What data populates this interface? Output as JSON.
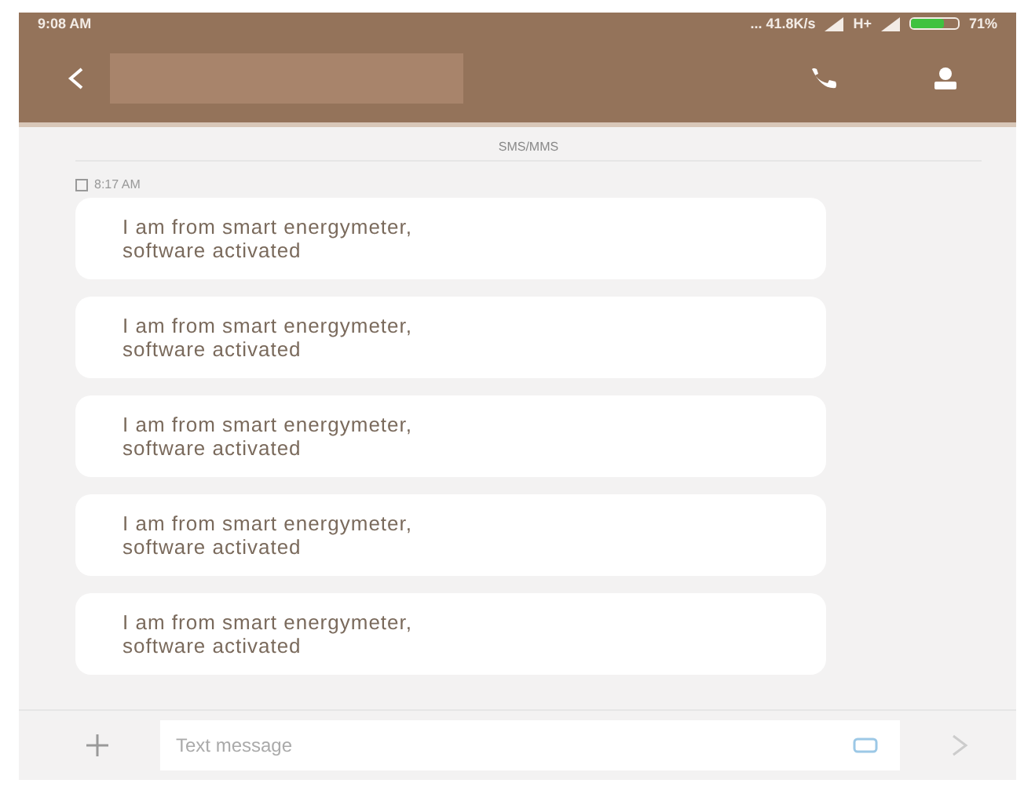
{
  "status_bar": {
    "time": "9:08 AM",
    "speed": "... 41.8K/s",
    "network": "H+",
    "battery": "71%",
    "battery_charge": {
      "level": 0.71
    }
  },
  "channel_label": "SMS/MMS",
  "timestamp": "8:17 AM",
  "messages": [
    {
      "text": "I am from smart energymeter,\nsoftware activated"
    },
    {
      "text": "I am from smart energymeter,\nsoftware activated"
    },
    {
      "text": "I am from smart energymeter,\nsoftware activated"
    },
    {
      "text": "I am from smart energymeter,\nsoftware activated"
    },
    {
      "text": "I am from smart energymeter,\nsoftware activated"
    }
  ],
  "composer": {
    "placeholder": "Text message"
  }
}
